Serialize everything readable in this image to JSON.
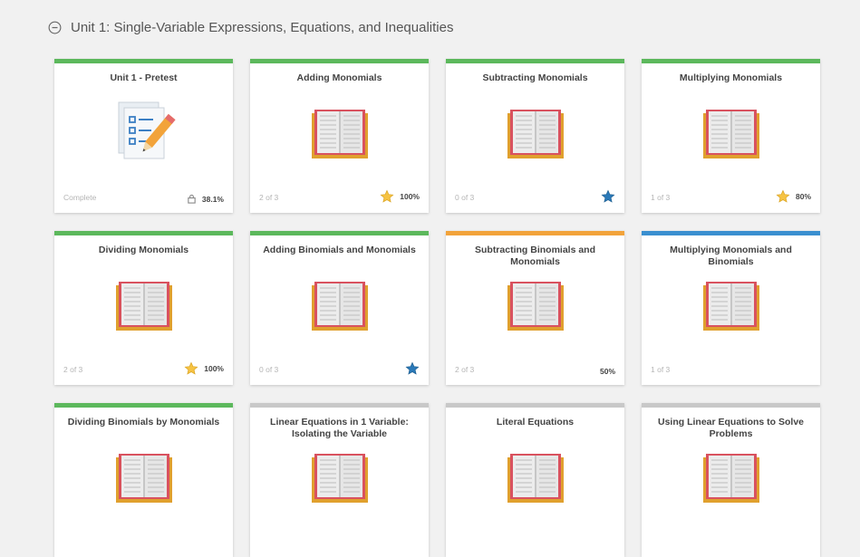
{
  "unit": {
    "title": "Unit 1: Single-Variable Expressions, Equations, and Inequalities"
  },
  "colors": {
    "green": "#5cb85c",
    "orange": "#f2a33a",
    "blue": "#3a8fd0",
    "grey": "#c8c8c8",
    "star_yellow": "#f6c343",
    "star_blue": "#2a79b8"
  },
  "cards": [
    {
      "title": "Unit 1 - Pretest",
      "status": "green",
      "art": "pretest-clipboard-icon",
      "progress": "Complete",
      "badge": "lock-icon",
      "score": "38.1%"
    },
    {
      "title": "Adding Monomials",
      "status": "green",
      "art": "book-icon",
      "progress": "2 of 3",
      "badge": "star-yellow-icon",
      "score": "100%"
    },
    {
      "title": "Subtracting Monomials",
      "status": "green",
      "art": "book-icon",
      "progress": "0 of 3",
      "badge": "star-blue-icon",
      "score": ""
    },
    {
      "title": "Multiplying Monomials",
      "status": "green",
      "art": "book-icon",
      "progress": "1 of 3",
      "badge": "star-yellow-icon",
      "score": "80%"
    },
    {
      "title": "Dividing Monomials",
      "status": "green",
      "art": "book-icon",
      "progress": "2 of 3",
      "badge": "star-yellow-icon",
      "score": "100%"
    },
    {
      "title": "Adding Binomials and Monomials",
      "status": "green",
      "art": "book-icon",
      "progress": "0 of 3",
      "badge": "star-blue-icon",
      "score": ""
    },
    {
      "title": "Subtracting Binomials and Monomials",
      "status": "orange",
      "art": "book-icon",
      "progress": "2 of 3",
      "badge": "",
      "score": "50%"
    },
    {
      "title": "Multiplying Monomials and Binomials",
      "status": "blue",
      "art": "book-icon",
      "progress": "1 of 3",
      "badge": "",
      "score": ""
    },
    {
      "title": "Dividing Binomials by Monomials",
      "status": "green",
      "art": "book-icon",
      "progress": "",
      "badge": "",
      "score": ""
    },
    {
      "title": "Linear Equations in 1 Variable: Isolating the Variable",
      "status": "grey",
      "art": "book-icon",
      "progress": "",
      "badge": "",
      "score": ""
    },
    {
      "title": "Literal Equations",
      "status": "grey",
      "art": "book-icon",
      "progress": "",
      "badge": "",
      "score": ""
    },
    {
      "title": "Using Linear Equations to Solve Problems",
      "status": "grey",
      "art": "book-icon",
      "progress": "",
      "badge": "",
      "score": ""
    }
  ]
}
